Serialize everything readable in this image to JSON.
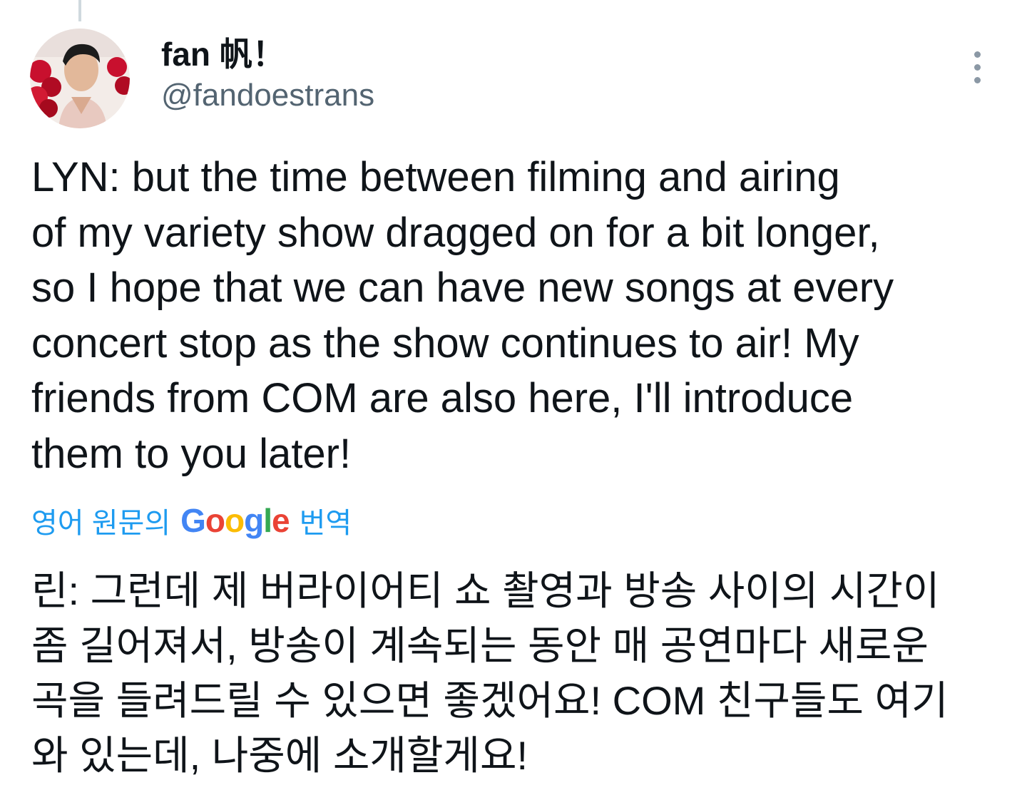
{
  "author": {
    "display_name": "fan 帆！",
    "handle": "@fandoestrans"
  },
  "tweet": {
    "lines": [
      "LYN: but the time between filming and airing",
      "of my variety show dragged on for a bit longer,",
      "so I hope that we can have new songs at every",
      "concert stop as the show continues to air! My",
      "friends from COM are also here, I'll introduce",
      "them to you later!"
    ]
  },
  "translation": {
    "prefix": "영어 원문의",
    "provider_letters": [
      "G",
      "o",
      "o",
      "g",
      "l",
      "e"
    ],
    "suffix": "번역",
    "lines": [
      "린: 그런데 제 버라이어티 쇼 촬영과 방송 사이의 시간이",
      "좀 길어져서, 방송이 계속되는 동안 매 공연마다 새로운",
      "곡을 들려드릴 수 있으면 좋겠어요! COM 친구들도 여기",
      "와 있는데, 나중에 소개할게요!"
    ]
  },
  "colors": {
    "link": "#1d9bf0",
    "text": "#0f1419",
    "secondary": "#536471"
  },
  "icons": {
    "more": "more-vertical-icon"
  }
}
